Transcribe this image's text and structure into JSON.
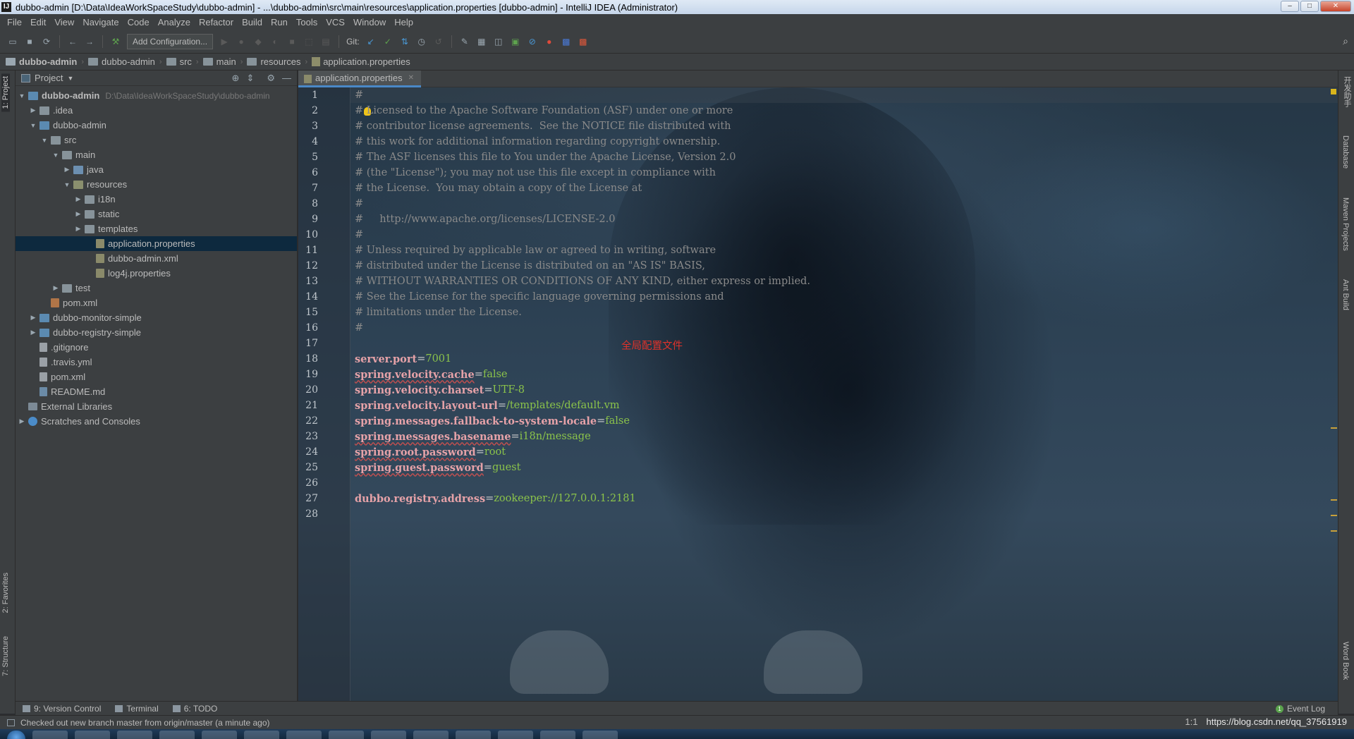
{
  "window": {
    "title": "dubbo-admin [D:\\Data\\IdeaWorkSpaceStudy\\dubbo-admin] - ...\\dubbo-admin\\src\\main\\resources\\application.properties [dubbo-admin] - IntelliJ IDEA (Administrator)",
    "app_icon": "IJ",
    "minimize": "–",
    "maximize": "□",
    "close": "✕"
  },
  "menu": [
    "File",
    "Edit",
    "View",
    "Navigate",
    "Code",
    "Analyze",
    "Refactor",
    "Build",
    "Run",
    "Tools",
    "VCS",
    "Window",
    "Help"
  ],
  "toolbar": {
    "add_configuration": "Add Configuration...",
    "git_label": "Git:"
  },
  "breadcrumb": [
    "dubbo-admin",
    "dubbo-admin",
    "src",
    "main",
    "resources",
    "application.properties"
  ],
  "left_tabs": {
    "project": "1: Project",
    "favorites": "2: Favorites",
    "structure": "7: Structure"
  },
  "project_panel": {
    "title": "Project",
    "tree": [
      {
        "label": "dubbo-admin",
        "path": "D:\\Data\\IdeaWorkSpaceStudy\\dubbo-admin"
      },
      {
        "label": ".idea"
      },
      {
        "label": "dubbo-admin"
      },
      {
        "label": "src"
      },
      {
        "label": "main"
      },
      {
        "label": "java"
      },
      {
        "label": "resources"
      },
      {
        "label": "i18n"
      },
      {
        "label": "static"
      },
      {
        "label": "templates"
      },
      {
        "label": "application.properties"
      },
      {
        "label": "dubbo-admin.xml"
      },
      {
        "label": "log4j.properties"
      },
      {
        "label": "test"
      },
      {
        "label": "pom.xml"
      },
      {
        "label": "dubbo-monitor-simple"
      },
      {
        "label": "dubbo-registry-simple"
      },
      {
        "label": ".gitignore"
      },
      {
        "label": ".travis.yml"
      },
      {
        "label": "pom.xml"
      },
      {
        "label": "README.md"
      },
      {
        "label": "External Libraries"
      },
      {
        "label": "Scratches and Consoles"
      }
    ]
  },
  "editor": {
    "tab_label": "application.properties",
    "annotation": "全局配置文件",
    "line_numbers": [
      "1",
      "2",
      "3",
      "4",
      "5",
      "6",
      "7",
      "8",
      "9",
      "10",
      "11",
      "12",
      "13",
      "14",
      "15",
      "16",
      "17",
      "18",
      "19",
      "20",
      "21",
      "22",
      "23",
      "24",
      "25",
      "26",
      "27",
      "28"
    ],
    "comments": [
      "#",
      "# Licensed to the Apache Software Foundation (ASF) under one or more",
      "# contributor license agreements.  See the NOTICE file distributed with",
      "# this work for additional information regarding copyright ownership.",
      "# The ASF licenses this file to You under the Apache License, Version 2.0",
      "# (the \"License\"); you may not use this file except in compliance with",
      "# the License.  You may obtain a copy of the License at",
      "#",
      "#     http://www.apache.org/licenses/LICENSE-2.0",
      "#",
      "# Unless required by applicable law or agreed to in writing, software",
      "# distributed under the License is distributed on an \"AS IS\" BASIS,",
      "# WITHOUT WARRANTIES OR CONDITIONS OF ANY KIND, either express or implied.",
      "# See the License for the specific language governing permissions and",
      "# limitations under the License.",
      "#"
    ],
    "properties": [
      {
        "key": "server.port",
        "value": "7001"
      },
      {
        "key": "spring.velocity.cache",
        "value": "false"
      },
      {
        "key": "spring.velocity.charset",
        "value": "UTF-8"
      },
      {
        "key": "spring.velocity.layout-url",
        "value": "/templates/default.vm"
      },
      {
        "key": "spring.messages.fallback-to-system-locale",
        "value": "false"
      },
      {
        "key": "spring.messages.basename",
        "value": "i18n/message"
      },
      {
        "key": "spring.root.password",
        "value": "root"
      },
      {
        "key": "spring.guest.password",
        "value": "guest"
      },
      {
        "key": "dubbo.registry.address",
        "value": "zookeeper://127.0.0.1:2181"
      }
    ],
    "equals": "="
  },
  "right_tabs": {
    "dev_helper": "开发助手",
    "database": "Database",
    "maven": "Maven Projects",
    "ant": "Ant Build",
    "word_book": "Word Book"
  },
  "bottom_tabs": {
    "version_control": "9: Version Control",
    "terminal": "Terminal",
    "todo": "6: TODO",
    "event_log": "Event Log"
  },
  "status": {
    "message": "Checked out new branch master from origin/master (a minute ago)",
    "position": "1:1",
    "watermark": "https://blog.csdn.net/qq_37561919"
  },
  "colors": {
    "comment": "#8a8a8a",
    "key": "#e6a2a8",
    "value": "#8bc34a",
    "annotation": "#e0322a",
    "selection": "#0d293e",
    "tab_underline": "#4a88c7"
  }
}
